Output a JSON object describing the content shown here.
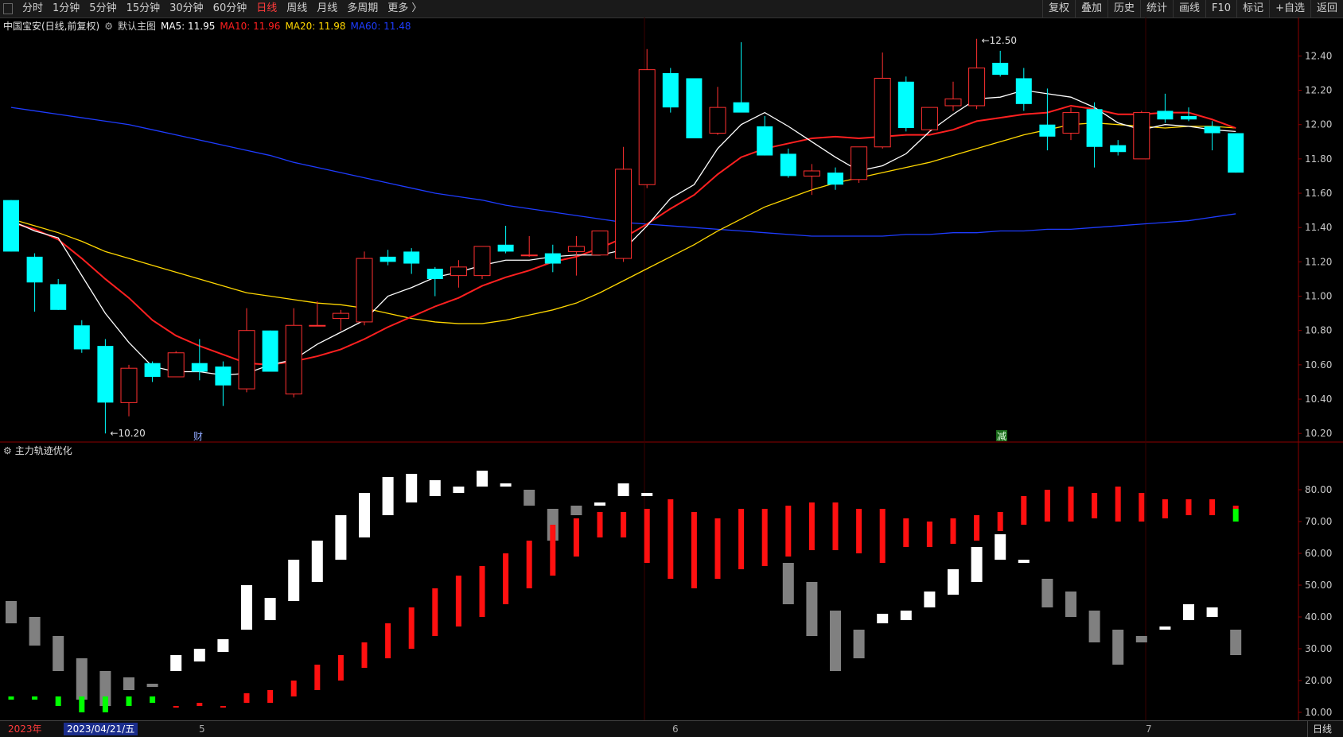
{
  "toolbar": {
    "left_items": [
      "分时",
      "1分钟",
      "5分钟",
      "15分钟",
      "30分钟",
      "60分钟",
      "日线",
      "周线",
      "月线",
      "多周期",
      "更多 〉"
    ],
    "active": "日线",
    "right_items": [
      "复权",
      "叠加",
      "历史",
      "统计",
      "画线",
      "F10",
      "标记",
      "+自选",
      "返回"
    ]
  },
  "legend": {
    "stock": "中国宝安(日线,前复权)",
    "main": "默认主图",
    "ma5": "MA5: 11.95",
    "ma10": "MA10: 11.96",
    "ma20": "MA20: 11.98",
    "ma60": "MA60: 11.48",
    "ma5_color": "#ffffff",
    "ma10_color": "#ff2020",
    "ma20_color": "#ffd700",
    "ma60_color": "#1e3cff"
  },
  "sub_legend": {
    "name": "主力轨迹优化"
  },
  "price_axis": [
    "12.40",
    "12.20",
    "12.00",
    "11.80",
    "11.60",
    "11.40",
    "11.20",
    "11.00",
    "10.80",
    "10.60",
    "10.40",
    "10.20"
  ],
  "sub_axis": [
    "80.00",
    "70.00",
    "60.00",
    "50.00",
    "40.00",
    "30.00",
    "20.00",
    "10.00"
  ],
  "annotations": {
    "high": "12.50",
    "low": "10.20",
    "marker1": "财",
    "marker2": "减"
  },
  "status": {
    "year": "2023年",
    "date": "2023/04/21/五",
    "m5": "5",
    "m6": "6",
    "m7": "7",
    "period": "日线"
  },
  "colors": {
    "up": "#ff3030",
    "down": "#00ffff",
    "bg": "#000000",
    "grid": "#8b0000"
  },
  "chart_data": {
    "type": "candlestick",
    "ohlc": [
      [
        11.56,
        11.56,
        11.26,
        11.26
      ],
      [
        11.23,
        11.25,
        10.91,
        11.08
      ],
      [
        11.07,
        11.1,
        10.92,
        10.92
      ],
      [
        10.83,
        10.86,
        10.67,
        10.69
      ],
      [
        10.71,
        10.75,
        10.2,
        10.38
      ],
      [
        10.38,
        10.6,
        10.3,
        10.58
      ],
      [
        10.61,
        10.62,
        10.5,
        10.53
      ],
      [
        10.53,
        10.68,
        10.54,
        10.67
      ],
      [
        10.61,
        10.75,
        10.51,
        10.56
      ],
      [
        10.59,
        10.62,
        10.36,
        10.48
      ],
      [
        10.46,
        10.93,
        10.44,
        10.8
      ],
      [
        10.8,
        10.8,
        10.6,
        10.56
      ],
      [
        10.43,
        10.93,
        10.41,
        10.83
      ],
      [
        10.83,
        10.97,
        10.83,
        10.83
      ],
      [
        10.87,
        10.92,
        10.8,
        10.9
      ],
      [
        10.85,
        11.26,
        10.83,
        11.22
      ],
      [
        11.23,
        11.27,
        11.18,
        11.2
      ],
      [
        11.26,
        11.28,
        11.13,
        11.19
      ],
      [
        11.16,
        11.17,
        11.0,
        11.1
      ],
      [
        11.12,
        11.21,
        11.05,
        11.17
      ],
      [
        11.12,
        11.28,
        11.1,
        11.29
      ],
      [
        11.3,
        11.41,
        11.25,
        11.26
      ],
      [
        11.24,
        11.35,
        11.23,
        11.24
      ],
      [
        11.25,
        11.3,
        11.14,
        11.19
      ],
      [
        11.26,
        11.35,
        11.12,
        11.29
      ],
      [
        11.24,
        11.37,
        11.24,
        11.38
      ],
      [
        11.22,
        11.87,
        11.2,
        11.74
      ],
      [
        11.65,
        12.44,
        11.63,
        12.32
      ],
      [
        12.3,
        12.33,
        12.07,
        12.1
      ],
      [
        12.27,
        12.25,
        12.05,
        11.92
      ],
      [
        11.95,
        12.22,
        11.94,
        12.1
      ],
      [
        12.13,
        12.48,
        12.08,
        12.07
      ],
      [
        11.99,
        12.05,
        11.82,
        11.82
      ],
      [
        11.83,
        11.86,
        11.69,
        11.7
      ],
      [
        11.7,
        11.77,
        11.59,
        11.73
      ],
      [
        11.72,
        11.75,
        11.62,
        11.65
      ],
      [
        11.68,
        11.87,
        11.66,
        11.87
      ],
      [
        11.87,
        12.42,
        11.86,
        12.27
      ],
      [
        12.25,
        12.28,
        11.96,
        11.98
      ],
      [
        11.97,
        12.1,
        11.96,
        12.1
      ],
      [
        12.11,
        12.25,
        12.08,
        12.15
      ],
      [
        12.11,
        12.5,
        12.09,
        12.33
      ],
      [
        12.36,
        12.43,
        12.28,
        12.29
      ],
      [
        12.27,
        12.33,
        12.08,
        12.12
      ],
      [
        12.0,
        12.21,
        11.85,
        11.93
      ],
      [
        11.95,
        12.1,
        11.91,
        12.07
      ],
      [
        12.09,
        12.13,
        11.75,
        11.87
      ],
      [
        11.88,
        11.91,
        11.82,
        11.84
      ],
      [
        11.8,
        12.08,
        11.8,
        12.07
      ],
      [
        12.08,
        12.18,
        12.01,
        12.03
      ],
      [
        12.05,
        12.1,
        12.02,
        12.03
      ],
      [
        11.99,
        12.02,
        11.85,
        11.95
      ],
      [
        11.95,
        11.95,
        11.72,
        11.72
      ]
    ],
    "ylim": [
      10.15,
      12.55
    ],
    "ma5": [
      11.44,
      11.38,
      11.34,
      11.12,
      10.9,
      10.73,
      10.59,
      10.56,
      10.56,
      10.54,
      10.55,
      10.6,
      10.63,
      10.72,
      10.79,
      10.86,
      11.0,
      11.05,
      11.11,
      11.14,
      11.18,
      11.21,
      11.21,
      11.23,
      11.24,
      11.24,
      11.27,
      11.41,
      11.57,
      11.65,
      11.86,
      12.0,
      12.07,
      11.99,
      11.9,
      11.81,
      11.73,
      11.76,
      11.83,
      11.96,
      12.06,
      12.15,
      12.16,
      12.2,
      12.18,
      12.16,
      12.1,
      12.01,
      11.97,
      12.0,
      11.99,
      11.97,
      11.96
    ],
    "ma10": [
      11.43,
      11.39,
      11.33,
      11.22,
      11.1,
      10.99,
      10.86,
      10.77,
      10.71,
      10.66,
      10.61,
      10.6,
      10.62,
      10.65,
      10.69,
      10.75,
      10.82,
      10.88,
      10.94,
      10.99,
      11.06,
      11.11,
      11.15,
      11.2,
      11.23,
      11.28,
      11.34,
      11.42,
      11.51,
      11.59,
      11.71,
      11.81,
      11.86,
      11.89,
      11.92,
      11.93,
      11.92,
      11.93,
      11.94,
      11.94,
      11.97,
      12.02,
      12.04,
      12.06,
      12.07,
      12.11,
      12.09,
      12.06,
      12.06,
      12.07,
      12.07,
      12.03,
      11.98
    ],
    "ma20": [
      11.45,
      11.41,
      11.37,
      11.32,
      11.26,
      11.22,
      11.18,
      11.14,
      11.1,
      11.06,
      11.02,
      11.0,
      10.98,
      10.96,
      10.95,
      10.93,
      10.9,
      10.87,
      10.85,
      10.84,
      10.84,
      10.86,
      10.89,
      10.92,
      10.96,
      11.02,
      11.09,
      11.16,
      11.23,
      11.3,
      11.38,
      11.45,
      11.52,
      11.57,
      11.62,
      11.66,
      11.69,
      11.72,
      11.75,
      11.78,
      11.82,
      11.86,
      11.9,
      11.94,
      11.97,
      12.0,
      12.01,
      12.0,
      11.99,
      11.98,
      11.99,
      11.99,
      11.98
    ],
    "ma60": [
      12.1,
      12.08,
      12.06,
      12.04,
      12.02,
      12.0,
      11.97,
      11.94,
      11.91,
      11.88,
      11.85,
      11.82,
      11.78,
      11.75,
      11.72,
      11.69,
      11.66,
      11.63,
      11.6,
      11.58,
      11.56,
      11.53,
      11.51,
      11.49,
      11.47,
      11.45,
      11.43,
      11.42,
      11.41,
      11.4,
      11.39,
      11.38,
      11.37,
      11.36,
      11.35,
      11.35,
      11.35,
      11.35,
      11.36,
      11.36,
      11.37,
      11.37,
      11.38,
      11.38,
      11.39,
      11.39,
      11.4,
      11.41,
      11.42,
      11.43,
      11.44,
      11.46,
      11.48
    ],
    "indicator": {
      "name": "主力轨迹优化",
      "ylim": [
        8,
        90
      ],
      "red_bars": [
        [
          0,
          0
        ],
        [
          0,
          0
        ],
        [
          0,
          0
        ],
        [
          0,
          0
        ],
        [
          0,
          0
        ],
        [
          0,
          0
        ],
        [
          0,
          0
        ],
        [
          12,
          12
        ],
        [
          12,
          13
        ],
        [
          12,
          12
        ],
        [
          13,
          16
        ],
        [
          13,
          17
        ],
        [
          15,
          20
        ],
        [
          17,
          25
        ],
        [
          20,
          28
        ],
        [
          24,
          32
        ],
        [
          27,
          38
        ],
        [
          30,
          43
        ],
        [
          34,
          49
        ],
        [
          37,
          53
        ],
        [
          40,
          56
        ],
        [
          44,
          60
        ],
        [
          49,
          64
        ],
        [
          53,
          69
        ],
        [
          59,
          71
        ],
        [
          65,
          73
        ],
        [
          65,
          73
        ],
        [
          57,
          74
        ],
        [
          52,
          77
        ],
        [
          49,
          73
        ],
        [
          52,
          71
        ],
        [
          55,
          74
        ],
        [
          56,
          74
        ],
        [
          59,
          75
        ],
        [
          61,
          76
        ],
        [
          61,
          76
        ],
        [
          60,
          74
        ],
        [
          57,
          74
        ],
        [
          62,
          71
        ],
        [
          62,
          70
        ],
        [
          63,
          71
        ],
        [
          64,
          72
        ],
        [
          67,
          73
        ],
        [
          69,
          78
        ],
        [
          70,
          80
        ],
        [
          70,
          81
        ],
        [
          71,
          79
        ],
        [
          70,
          81
        ],
        [
          70,
          79
        ],
        [
          71,
          77
        ],
        [
          72,
          77
        ],
        [
          72,
          77
        ],
        [
          74,
          75
        ]
      ],
      "other_bars": [
        [
          38,
          45,
          "#808080"
        ],
        [
          31,
          40,
          "#808080"
        ],
        [
          23,
          34,
          "#808080"
        ],
        [
          14,
          27,
          "#808080"
        ],
        [
          12,
          23,
          "#808080"
        ],
        [
          17,
          21,
          "#808080"
        ],
        [
          18,
          19,
          "#808080"
        ],
        [
          23,
          28,
          "#ffffff"
        ],
        [
          26,
          30,
          "#ffffff"
        ],
        [
          29,
          33,
          "#ffffff"
        ],
        [
          36,
          50,
          "#ffffff"
        ],
        [
          39,
          46,
          "#ffffff"
        ],
        [
          45,
          58,
          "#ffffff"
        ],
        [
          51,
          64,
          "#ffffff"
        ],
        [
          58,
          72,
          "#ffffff"
        ],
        [
          65,
          79,
          "#ffffff"
        ],
        [
          72,
          84,
          "#ffffff"
        ],
        [
          76,
          85,
          "#ffffff"
        ],
        [
          78,
          83,
          "#ffffff"
        ],
        [
          79,
          81,
          "#ffffff"
        ],
        [
          81,
          86,
          "#ffffff"
        ],
        [
          81,
          82,
          "#ffffff"
        ],
        [
          75,
          80,
          "#808080"
        ],
        [
          64,
          74,
          "#808080"
        ],
        [
          72,
          75,
          "#808080"
        ],
        [
          75,
          76,
          "#ffffff"
        ],
        [
          78,
          82,
          "#ffffff"
        ],
        [
          78,
          79,
          "#ffffff"
        ],
        [
          0,
          0,
          "#000000"
        ],
        [
          0,
          0,
          "#000000"
        ],
        [
          0,
          0,
          "#000000"
        ],
        [
          0,
          0,
          "#000000"
        ],
        [
          0,
          0,
          "#000000"
        ],
        [
          44,
          57,
          "#808080"
        ],
        [
          34,
          51,
          "#808080"
        ],
        [
          23,
          42,
          "#808080"
        ],
        [
          27,
          36,
          "#808080"
        ],
        [
          38,
          41,
          "#ffffff"
        ],
        [
          39,
          42,
          "#ffffff"
        ],
        [
          43,
          48,
          "#ffffff"
        ],
        [
          47,
          55,
          "#ffffff"
        ],
        [
          51,
          62,
          "#ffffff"
        ],
        [
          58,
          66,
          "#ffffff"
        ],
        [
          57,
          58,
          "#ffffff"
        ],
        [
          43,
          52,
          "#808080"
        ],
        [
          40,
          48,
          "#808080"
        ],
        [
          32,
          42,
          "#808080"
        ],
        [
          25,
          36,
          "#808080"
        ],
        [
          32,
          34,
          "#808080"
        ],
        [
          36,
          37,
          "#ffffff"
        ],
        [
          39,
          44,
          "#ffffff"
        ],
        [
          40,
          43,
          "#ffffff"
        ],
        [
          28,
          36,
          "#808080"
        ]
      ],
      "green_bars": [
        [
          14,
          15
        ],
        [
          14,
          15
        ],
        [
          12,
          15
        ],
        [
          10,
          15
        ],
        [
          10,
          15
        ],
        [
          12,
          15
        ],
        [
          13,
          15
        ]
      ],
      "last_green": [
        70,
        74
      ]
    }
  }
}
